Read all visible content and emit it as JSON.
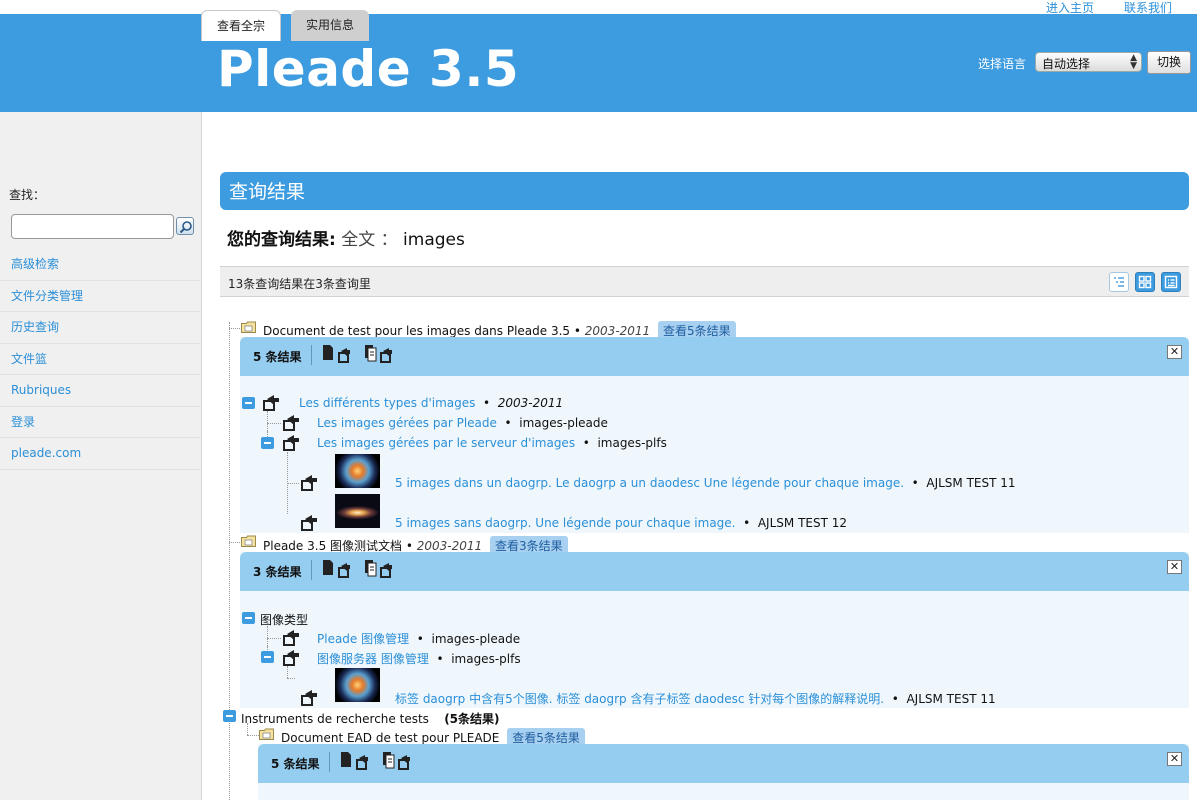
{
  "top_links": {
    "home": "进入主页",
    "contact": "联系我们"
  },
  "banner": {
    "logo": "Pleade 3.5",
    "lang_label": "选择语言",
    "lang_selected": "自动选择",
    "switch_button": "切换"
  },
  "tabs": [
    {
      "label": "查看全宗",
      "active": true
    },
    {
      "label": "实用信息",
      "active": false
    }
  ],
  "sidebar": {
    "find_label": "查找：",
    "search_placeholder": "",
    "items": [
      "高级检索",
      "文件分类管理",
      "历史查询",
      "文件篮",
      "Rubriques",
      "登录",
      "pleade.com"
    ]
  },
  "results": {
    "header": "查询结果",
    "query_label": "您的查询结果:",
    "query_field": "全文",
    "query_sep": "：",
    "query_value": "images",
    "count_text": "13条查询结果在3条查询里"
  },
  "groups": [
    {
      "title": "Document de test pour les images dans Pleade 3.5",
      "sep": "•",
      "date": "2003-2011",
      "view_label": "查看5条结果",
      "panel_count": "5 条结果",
      "items": [
        {
          "text": "Les différents types d'images",
          "meta": "2003-2011",
          "italic": true
        },
        {
          "text": "Les images gérées par Pleade",
          "meta": "images-pleade"
        },
        {
          "text": "Les images gérées par le serveur d'images",
          "meta": "images-plfs"
        },
        {
          "text": "5 images dans un daogrp. Le daogrp a un daodesc Une légende pour chaque image.",
          "meta": "AJLSM TEST 11"
        },
        {
          "text": "5 images sans daogrp. Une légende pour chaque image.",
          "meta": "AJLSM TEST 12"
        }
      ]
    },
    {
      "title": "Pleade 3.5 图像测试文档",
      "sep": "•",
      "date": "2003-2011",
      "view_label": "查看3条结果",
      "panel_count": "3 条结果",
      "items": [
        {
          "text": "图像类型",
          "meta": ""
        },
        {
          "text": "Pleade 图像管理",
          "meta": "images-pleade"
        },
        {
          "text": "图像服务器 图像管理",
          "meta": "images-plfs"
        },
        {
          "text": "标签 daogrp 中含有5个图像. 标签 daogrp 含有子标签 daodesc 针对每个图像的解释说明.",
          "meta": "AJLSM TEST 11"
        }
      ]
    }
  ],
  "instruments": {
    "label": "Instruments de recherche tests",
    "count": "(5条结果)",
    "doc_title": "Document EAD de test pour PLEADE",
    "view_label": "查看5条结果",
    "panel_count": "5 条结果"
  },
  "bullet": "•",
  "colors": {
    "brand_blue": "#3d9be0",
    "panel_head": "#95cdf0",
    "link": "#2b8fd8"
  }
}
